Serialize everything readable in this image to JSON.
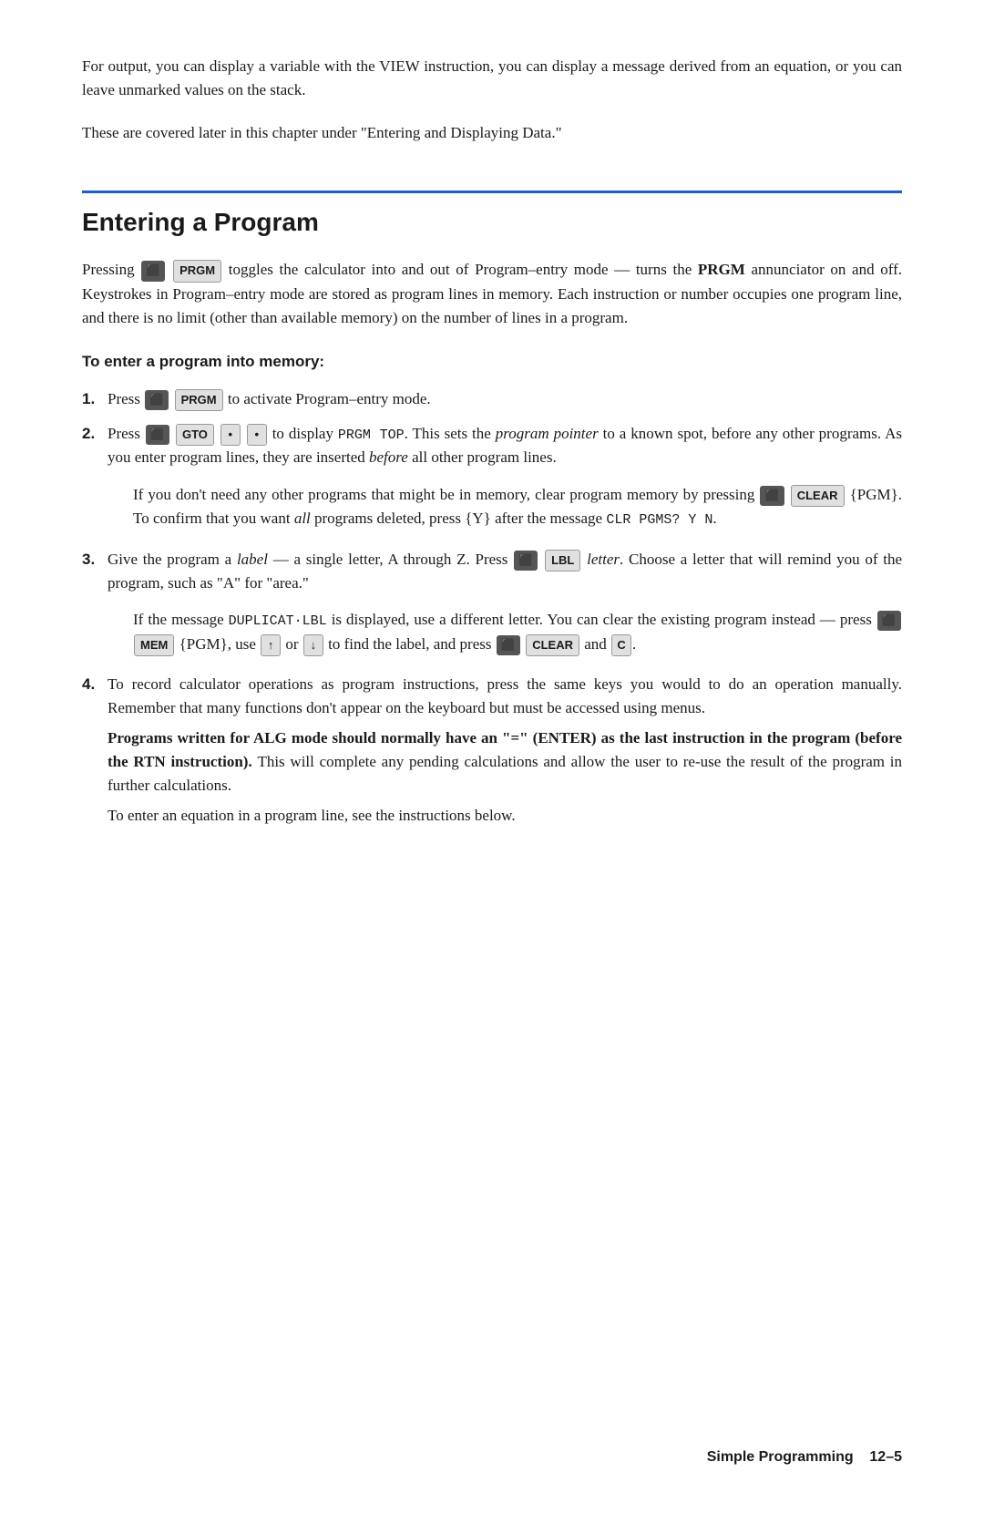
{
  "intro": {
    "paragraph1": "For output, you can display a variable with the VIEW instruction, you can display a message derived from an equation, or you can leave unmarked values on the stack.",
    "paragraph2": "These are covered later in this chapter under \"Entering and Displaying Data.\""
  },
  "section": {
    "title": "Entering a Program",
    "intro": "Pressing  toggles the calculator into and out of Program–entry mode — turns the PRGM annunciator on and off. Keystrokes in Program–entry mode are stored as program lines in memory. Each instruction or number occupies one program line, and there is no limit (other than available memory) on the number of lines in a program.",
    "subsection_title": "To enter a program into memory:",
    "steps": [
      {
        "num": "1.",
        "text": "Press  to activate Program–entry mode."
      },
      {
        "num": "2.",
        "text": "Press  GTO  •  •  to display PRGM TOP. This sets the program pointer to a known spot, before any other programs. As you enter program lines, they are inserted before all other program lines.",
        "note": "If you don't need any other programs that might be in memory, clear program memory by pressing   {PGM}. To confirm that you want all programs deleted, press {Y} after the message CLR PGMS? Y N."
      },
      {
        "num": "3.",
        "text": "Give the program a label — a single letter, A through Z. Press  LBL letter. Choose a letter that will remind you of the program, such as \"A\" for \"area.\"",
        "note": "If the message DUPLICAT·LBL is displayed, use a different letter. You can clear the existing program instead — press  MEM {PGM}, use  ↑  or  ↓  to find the label, and press  CLEAR and C."
      },
      {
        "num": "4.",
        "text": "To record calculator operations as program instructions, press the same keys you would to do an operation manually. Remember that many functions don't appear on the keyboard but must be accessed using menus.",
        "bold_stmt": "Programs written for ALG mode should normally have an \"=\" (ENTER) as the last instruction in the program (before the RTN instruction).",
        "bold_end": " This will complete any pending calculations and allow the user to re-use the result of the program in further calculations.",
        "final": "To enter an equation in a program line, see the instructions below."
      }
    ]
  },
  "footer": {
    "text": "Simple Programming",
    "page": "12–5"
  }
}
